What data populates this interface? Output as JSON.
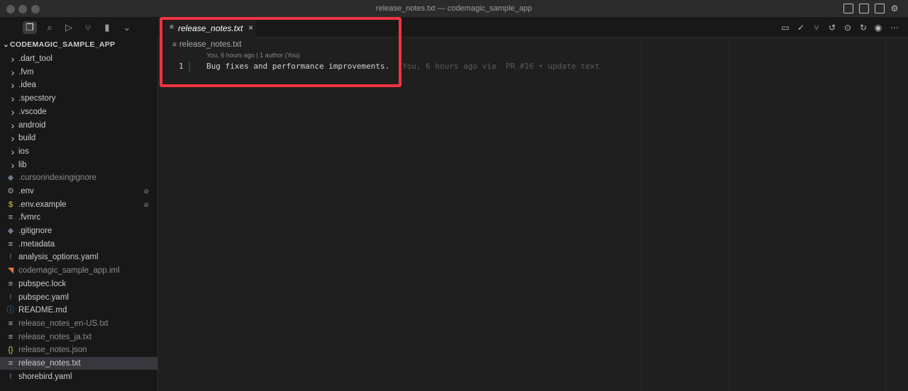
{
  "window": {
    "title": "release_notes.txt — codemagic_sample_app"
  },
  "activity_bar": {
    "icons": [
      "files-icon",
      "search-icon",
      "run-debug-icon",
      "source-control-icon",
      "book-icon",
      "chevron-down-icon"
    ]
  },
  "sidebar": {
    "header": "CODEMAGIC_SAMPLE_APP",
    "folders": [
      ".dart_tool",
      ".fvm",
      ".idea",
      ".specstory",
      ".vscode",
      "android",
      "build",
      "ios",
      "lib"
    ],
    "files": [
      {
        "label": ".cursorindexingignore",
        "icon": "◆",
        "icon_color": "#6c7a89",
        "dim": true
      },
      {
        "label": ".env",
        "icon": "⚙",
        "icon_color": "#9d9d9d",
        "dim": false,
        "badge": "⊘"
      },
      {
        "label": ".env.example",
        "icon": "$",
        "icon_color": "#e8c53a",
        "dim": false,
        "badge": "⊘"
      },
      {
        "label": ".fvmrc",
        "icon": "≡",
        "icon_color": "#bdbdbd",
        "dim": false
      },
      {
        "label": ".gitignore",
        "icon": "◆",
        "icon_color": "#6c7a89",
        "dim": false
      },
      {
        "label": ".metadata",
        "icon": "≡",
        "icon_color": "#bdbdbd",
        "dim": false
      },
      {
        "label": "analysis_options.yaml",
        "icon": "!",
        "icon_color": "#a074c4",
        "dim": false
      },
      {
        "label": "codemagic_sample_app.iml",
        "icon": "◥",
        "icon_color": "#e37933",
        "dim": true
      },
      {
        "label": "pubspec.lock",
        "icon": "≡",
        "icon_color": "#bdbdbd",
        "dim": false
      },
      {
        "label": "pubspec.yaml",
        "icon": "!",
        "icon_color": "#a074c4",
        "dim": false
      },
      {
        "label": "README.md",
        "icon": "ⓘ",
        "icon_color": "#519aba",
        "dim": false
      },
      {
        "label": "release_notes_en-US.txt",
        "icon": "≡",
        "icon_color": "#bdbdbd",
        "dim": true
      },
      {
        "label": "release_notes_ja.txt",
        "icon": "≡",
        "icon_color": "#bdbdbd",
        "dim": true
      },
      {
        "label": "release_notes.json",
        "icon": "{}",
        "icon_color": "#cbcb41",
        "dim": true
      },
      {
        "label": "release_notes.txt",
        "icon": "≡",
        "icon_color": "#bdbdbd",
        "dim": false,
        "selected": true
      },
      {
        "label": "shorebird.yaml",
        "icon": "!",
        "icon_color": "#a074c4",
        "dim": false
      }
    ]
  },
  "tab": {
    "label": "release_notes.txt",
    "close": "×"
  },
  "editor": {
    "breadcrumb": "release_notes.txt",
    "codelens": "You, 6 hours ago | 1 author (You)",
    "line_number": "1",
    "line_text": "Bug fixes and performance improvements.",
    "blame": "You, 6 hours ago via  PR #16 • update text"
  },
  "colors": {
    "highlight": "#ef3340",
    "selection": "#37373d"
  }
}
